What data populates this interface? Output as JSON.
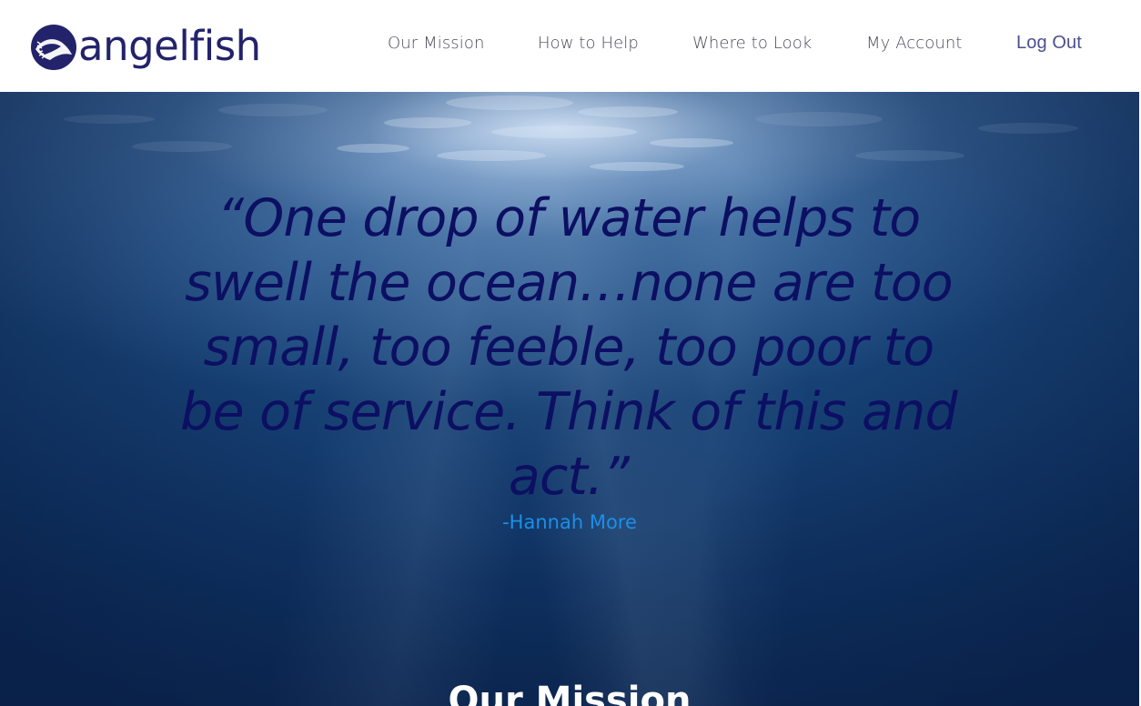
{
  "brand": {
    "name": "angelfish",
    "logo_icon": "angelfish-logo-icon",
    "primary_color": "#23236b"
  },
  "nav": {
    "items": [
      {
        "label": "Our Mission"
      },
      {
        "label": "How to Help"
      },
      {
        "label": "Where to Look"
      },
      {
        "label": "My Account"
      }
    ],
    "logout_label": "Log Out"
  },
  "hero": {
    "quote_lines": [
      "“One drop of water helps to",
      "swell the ocean…none are too",
      "small, too feeble, too poor to",
      "be of service. Think of this and",
      "act.”"
    ],
    "author": "-Hannah More",
    "quote_color": "#0c0f62",
    "author_color": "#1c8fe8"
  },
  "section": {
    "title": "Our Mission"
  }
}
